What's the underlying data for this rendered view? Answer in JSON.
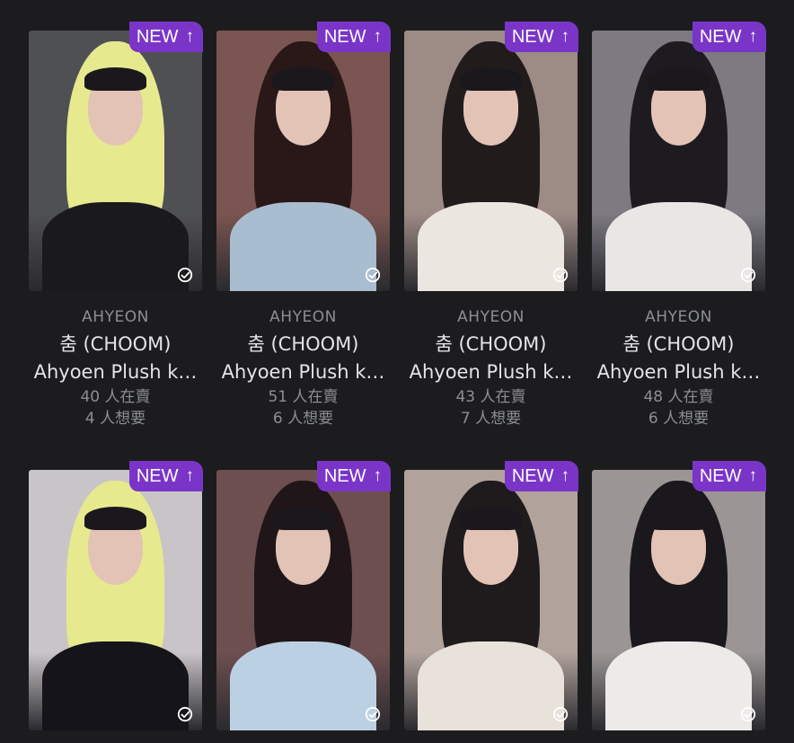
{
  "badge": {
    "label": "NEW",
    "arrow": "↑"
  },
  "cards": [
    {
      "artist": "AHYEON",
      "album": "춤 (CHOOM)",
      "title": "Ahyoen Plush k…",
      "selling": "40 人在賣",
      "wanting": "4 人想要",
      "photo_colors": [
        "#4f5054",
        "#1a1a1c",
        "#e6e98e"
      ]
    },
    {
      "artist": "AHYEON",
      "album": "춤 (CHOOM)",
      "title": "Ahyoen Plush k…",
      "selling": "51 人在賣",
      "wanting": "6 人想要",
      "photo_colors": [
        "#7b5551",
        "#a9bdd0",
        "#2a1718"
      ]
    },
    {
      "artist": "AHYEON",
      "album": "춤 (CHOOM)",
      "title": "Ahyoen Plush k…",
      "selling": "43 人在賣",
      "wanting": "7 人想要",
      "photo_colors": [
        "#9d8b86",
        "#ece6e1",
        "#221b1c"
      ]
    },
    {
      "artist": "AHYEON",
      "album": "춤 (CHOOM)",
      "title": "Ahyoen Plush k…",
      "selling": "48 人在賣",
      "wanting": "6 人想要",
      "photo_colors": [
        "#7d7a82",
        "#e9e6e6",
        "#1d1b20"
      ]
    },
    {
      "artist": "",
      "album": "",
      "title": "",
      "selling": "",
      "wanting": "",
      "photo_colors": [
        "#c9c4c7",
        "#15141a",
        "#e6e98e"
      ]
    },
    {
      "artist": "",
      "album": "",
      "title": "",
      "selling": "",
      "wanting": "",
      "photo_colors": [
        "#6e4f50",
        "#bcd0e3",
        "#20161a"
      ]
    },
    {
      "artist": "",
      "album": "",
      "title": "",
      "selling": "",
      "wanting": "",
      "photo_colors": [
        "#b1a29c",
        "#e9e2db",
        "#1f1a1b"
      ]
    },
    {
      "artist": "",
      "album": "",
      "title": "",
      "selling": "",
      "wanting": "",
      "photo_colors": [
        "#9b9595",
        "#eeeaea",
        "#1a181d"
      ]
    }
  ]
}
